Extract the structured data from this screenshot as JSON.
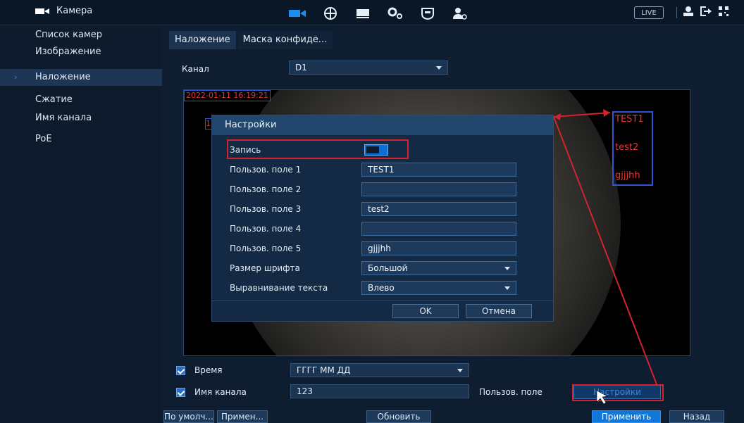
{
  "topbar": {
    "app_title": "Камера",
    "app_icon": "camera-icon",
    "nav_icons": [
      "camera-icon",
      "network-icon",
      "storage-icon",
      "system-icon",
      "security-icon",
      "account-icon"
    ],
    "live_label": "LIVE",
    "right_icons": [
      "user-icon",
      "logout-icon",
      "qr-code-icon"
    ],
    "accent_color": "#0b6fd3"
  },
  "sidebar": {
    "items": [
      {
        "label": "Список камер"
      },
      {
        "label": "Изображение"
      },
      {
        "label": "Наложение",
        "active": true
      },
      {
        "label": "Сжатие"
      },
      {
        "label": "Имя канала"
      },
      {
        "label": "PoE"
      }
    ]
  },
  "main": {
    "tabs": [
      "Наложение",
      "Маска конфиде..."
    ],
    "channel_label": "Канал",
    "channel_value": "D1",
    "preview": {
      "datetime_overlay": "2022-01-11 16:19:21",
      "fragment": "1",
      "custom_lines": [
        "TEST1",
        "test2",
        "gjjjhh"
      ]
    },
    "time_label": "Время",
    "time_format_value": "ГГГГ ММ ДД",
    "channel_name_label": "Имя канала",
    "channel_name_value": "123",
    "custom_field_label": "Пользов. поле",
    "settings_button": "Настройки"
  },
  "dialog": {
    "title": "Настройки",
    "record_label": "Запись",
    "fields": [
      {
        "label": "Пользов. поле 1",
        "value": "TEST1"
      },
      {
        "label": "Пользов. поле 2",
        "value": ""
      },
      {
        "label": "Пользов. поле 3",
        "value": "test2"
      },
      {
        "label": "Пользов. поле 4",
        "value": ""
      },
      {
        "label": "Пользов. поле 5",
        "value": "gjjjhh"
      }
    ],
    "font_size_label": "Размер шрифта",
    "font_size_value": "Большой",
    "align_label": "Выравнивание текста",
    "align_value": "Влево",
    "ok": "OK",
    "cancel": "Отмена"
  },
  "bottom": {
    "default": "По умолч...",
    "copy": "Примен...",
    "refresh": "Обновить",
    "apply": "Применить",
    "back": "Назад"
  }
}
